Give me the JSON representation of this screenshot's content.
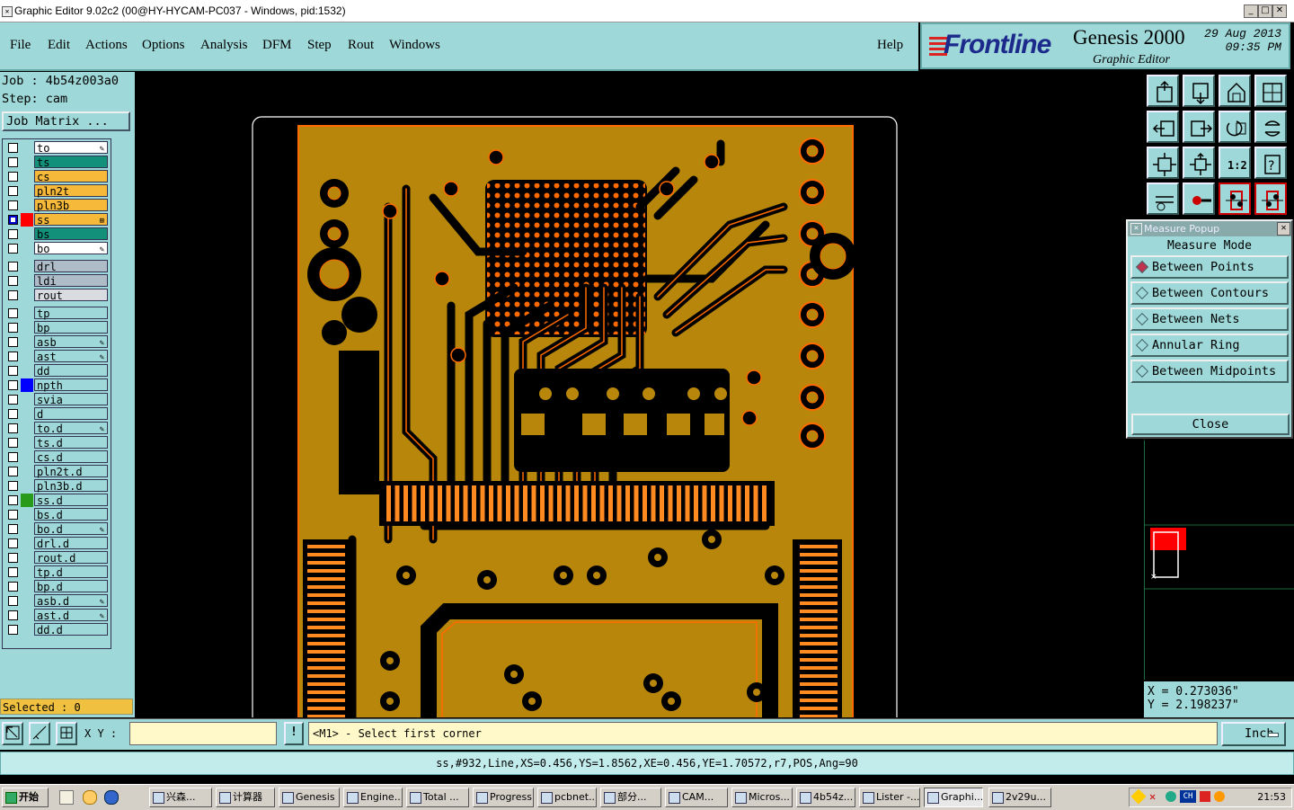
{
  "window": {
    "title": "Graphic Editor 9.02c2 (00@HY-HYCAM-PC037 - Windows, pid:1532)",
    "buttons": [
      "_",
      "□",
      "✕"
    ]
  },
  "menu": {
    "items": [
      "File",
      "Edit",
      "Actions",
      "Options",
      "Analysis",
      "DFM",
      "Step",
      "Rout",
      "Windows"
    ],
    "help": "Help"
  },
  "brand": {
    "logo": "Frontline",
    "product": "Genesis 2000",
    "subtitle": "Graphic Editor",
    "date": "29 Aug 2013",
    "time": "09:35 PM"
  },
  "left": {
    "job": "Job : 4b54z003a0",
    "step": "Step: cam",
    "job_matrix": "Job Matrix ...",
    "selected": "Selected : 0",
    "layers": [
      {
        "name": "to",
        "bg": "#ffffff",
        "mark": "✎",
        "color": ""
      },
      {
        "name": "ts",
        "bg": "#12907a",
        "mark": "",
        "color": ""
      },
      {
        "name": "cs",
        "bg": "#f6b93a",
        "mark": "",
        "color": ""
      },
      {
        "name": "pln2t",
        "bg": "#f6b93a",
        "mark": "",
        "color": ""
      },
      {
        "name": "pln3b",
        "bg": "#f6b93a",
        "mark": "",
        "color": ""
      },
      {
        "name": "ss",
        "bg": "#f6b93a",
        "mark": "⊞",
        "color": "#ff0000",
        "affected": true
      },
      {
        "name": "bs",
        "bg": "#12907a",
        "mark": "",
        "color": ""
      },
      {
        "name": "bo",
        "bg": "#ffffff",
        "mark": "✎",
        "color": ""
      },
      {
        "name": "drl",
        "bg": "#aebcc8",
        "mark": "",
        "color": "",
        "gap": true
      },
      {
        "name": "ldi",
        "bg": "#aebcc8",
        "mark": "",
        "color": ""
      },
      {
        "name": "rout",
        "bg": "#d8dce0",
        "mark": "",
        "color": ""
      },
      {
        "name": "tp",
        "bg": "#9ed8d8",
        "mark": "",
        "color": "",
        "gap": true
      },
      {
        "name": "bp",
        "bg": "#9ed8d8",
        "mark": "",
        "color": ""
      },
      {
        "name": "asb",
        "bg": "#9ed8d8",
        "mark": "✎",
        "color": ""
      },
      {
        "name": "ast",
        "bg": "#9ed8d8",
        "mark": "✎",
        "color": ""
      },
      {
        "name": "dd",
        "bg": "#9ed8d8",
        "mark": "",
        "color": ""
      },
      {
        "name": "npth",
        "bg": "#9ed8d8",
        "mark": "",
        "color": "#0000ff"
      },
      {
        "name": "svia",
        "bg": "#9ed8d8",
        "mark": "",
        "color": ""
      },
      {
        "name": "d",
        "bg": "#9ed8d8",
        "mark": "",
        "color": ""
      },
      {
        "name": "to.d",
        "bg": "#9ed8d8",
        "mark": "✎",
        "color": ""
      },
      {
        "name": "ts.d",
        "bg": "#9ed8d8",
        "mark": "",
        "color": ""
      },
      {
        "name": "cs.d",
        "bg": "#9ed8d8",
        "mark": "",
        "color": ""
      },
      {
        "name": "pln2t.d",
        "bg": "#9ed8d8",
        "mark": "",
        "color": ""
      },
      {
        "name": "pln3b.d",
        "bg": "#9ed8d8",
        "mark": "",
        "color": ""
      },
      {
        "name": "ss.d",
        "bg": "#9ed8d8",
        "mark": "",
        "color": "#2a9a1a"
      },
      {
        "name": "bs.d",
        "bg": "#9ed8d8",
        "mark": "",
        "color": ""
      },
      {
        "name": "bo.d",
        "bg": "#9ed8d8",
        "mark": "✎",
        "color": ""
      },
      {
        "name": "drl.d",
        "bg": "#9ed8d8",
        "mark": "",
        "color": ""
      },
      {
        "name": "rout.d",
        "bg": "#9ed8d8",
        "mark": "",
        "color": ""
      },
      {
        "name": "tp.d",
        "bg": "#9ed8d8",
        "mark": "",
        "color": ""
      },
      {
        "name": "bp.d",
        "bg": "#9ed8d8",
        "mark": "",
        "color": ""
      },
      {
        "name": "asb.d",
        "bg": "#9ed8d8",
        "mark": "✎",
        "color": ""
      },
      {
        "name": "ast.d",
        "bg": "#9ed8d8",
        "mark": "✎",
        "color": ""
      },
      {
        "name": "dd.d",
        "bg": "#9ed8d8",
        "mark": "",
        "color": ""
      }
    ]
  },
  "tools": [
    "zoom-home-icon",
    "zoom-in-icon",
    "home-icon",
    "view-window-icon",
    "pan-left-icon",
    "pan-right-icon",
    "redraw-icon",
    "refresh-icon",
    "fit-icon",
    "zoom-center-icon",
    "scale-1-2-icon",
    "help-icon",
    "snap-icon",
    "measure-icon",
    "net-highlight-icon",
    "net-select-icon"
  ],
  "tool_texts": {
    "scale": "1:2",
    "help": "?"
  },
  "measure": {
    "title": "Measure Popup",
    "mode_label": "Measure Mode",
    "options": [
      "Between Points",
      "Between Contours",
      "Between Nets",
      "Annular Ring",
      "Between Midpoints"
    ],
    "selected_index": 0,
    "close": "Close"
  },
  "coords": {
    "x": "X = 0.273036\"",
    "y": "Y = 2.198237\""
  },
  "command": {
    "xy_label": "X Y :",
    "xy_value": "",
    "bang": "!",
    "prompt": "<M1> - Select first corner",
    "unit": "Inch",
    "status": "ss,#932,Line,XS=0.456,YS=1.8562,XE=0.456,YE=1.70572,r7,POS,Ang=90"
  },
  "taskbar": {
    "start": "开始",
    "tasks": [
      "兴森...",
      "计算器",
      "Genesis",
      "Engine...",
      "Total ...",
      "Progress",
      "pcbnet...",
      "部分...",
      "CAM...",
      "Micros...",
      "4b54z...",
      "Lister -...",
      "Graphi...",
      "2v29u..."
    ],
    "active_index": 12,
    "clock": "21:53"
  },
  "colors": {
    "panel": "#9ed8d8",
    "copper": "#b8860b",
    "trace_edge": "#ff6a00",
    "canvas": "#000000"
  }
}
